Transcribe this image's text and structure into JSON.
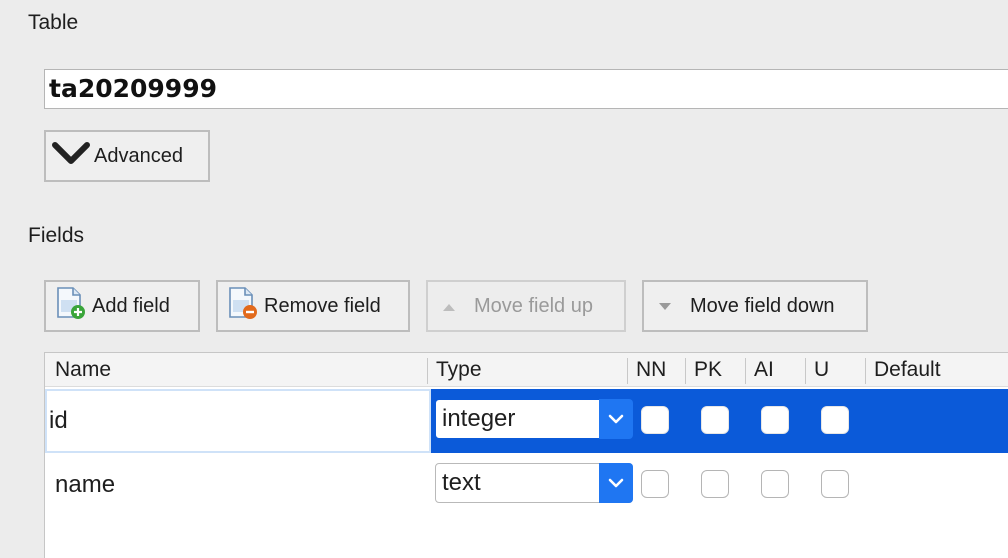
{
  "table_section": {
    "label": "Table",
    "name_value": "ta20209999",
    "advanced_label": "Advanced"
  },
  "fields_section": {
    "label": "Fields",
    "toolbar": {
      "add_label": "Add field",
      "remove_label": "Remove field",
      "move_up_label": "Move field up",
      "move_down_label": "Move field down"
    },
    "columns": [
      "Name",
      "Type",
      "NN",
      "PK",
      "AI",
      "U",
      "Default"
    ],
    "rows": [
      {
        "name": "id",
        "type": "integer",
        "nn": false,
        "pk": false,
        "ai": false,
        "u": false,
        "default": "",
        "selected": true
      },
      {
        "name": "name",
        "type": "text",
        "nn": false,
        "pk": false,
        "ai": false,
        "u": false,
        "default": "",
        "selected": false
      }
    ]
  },
  "colors": {
    "selection": "#0b5ad9",
    "dropdown_accent": "#1f76f2",
    "window_bg": "#ececec"
  },
  "icons": [
    "chevron-down-icon",
    "add-document-icon",
    "remove-document-icon",
    "triangle-up-icon",
    "triangle-down-icon",
    "dropdown-chevron-icon"
  ]
}
